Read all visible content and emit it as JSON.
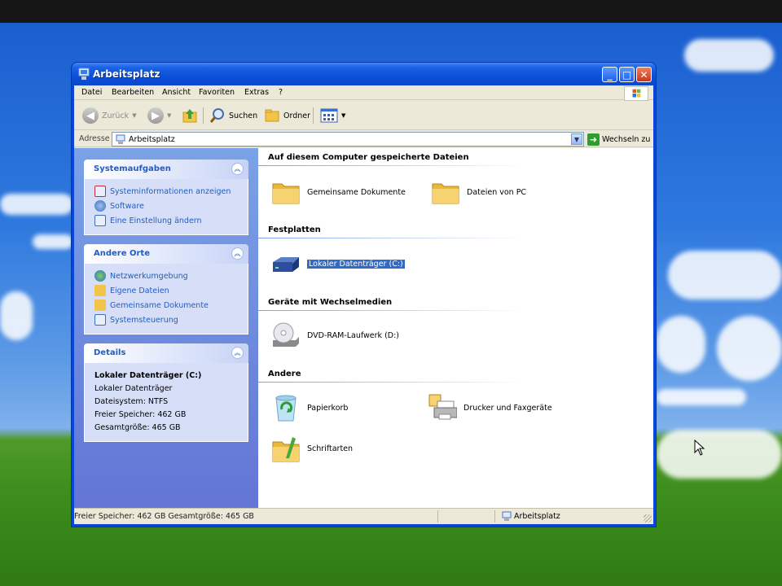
{
  "window": {
    "title": "Arbeitsplatz",
    "minimize": "_",
    "maximize": "□",
    "close": "✕"
  },
  "menu": [
    "Datei",
    "Bearbeiten",
    "Ansicht",
    "Favoriten",
    "Extras",
    "?"
  ],
  "toolbar": {
    "back_label": "Zurück",
    "search_label": "Suchen",
    "folders_label": "Ordner"
  },
  "address": {
    "label": "Adresse",
    "value": "Arbeitsplatz",
    "go_label": "Wechseln zu"
  },
  "left": {
    "system_tasks": {
      "title": "Systemaufgaben",
      "items": [
        "Systeminformationen anzeigen",
        "Software",
        "Eine Einstellung ändern"
      ]
    },
    "other_places": {
      "title": "Andere Orte",
      "items": [
        "Netzwerkumgebung",
        "Eigene Dateien",
        "Gemeinsame Dokumente",
        "Systemsteuerung"
      ]
    },
    "details": {
      "title": "Details",
      "name": "Lokaler Datenträger (C:)",
      "type": "Lokaler Datenträger",
      "filesystem": "Dateisystem: NTFS",
      "free": "Freier Speicher: 462 GB",
      "total": "Gesamtgröße: 465 GB"
    }
  },
  "groups": {
    "stored_files": {
      "title": "Auf diesem Computer gespeicherte Dateien",
      "items": [
        "Gemeinsame Dokumente",
        "Dateien von PC"
      ]
    },
    "hard_disks": {
      "title": "Festplatten",
      "items": [
        "Lokaler Datenträger (C:)"
      ]
    },
    "removable": {
      "title": "Geräte mit Wechselmedien",
      "items": [
        "DVD-RAM-Laufwerk (D:)"
      ]
    },
    "other": {
      "title": "Andere",
      "items": [
        "Papierkorb",
        "Drucker und Faxgeräte",
        "Schriftarten"
      ]
    }
  },
  "status": {
    "left": "Freier Speicher: 462 GB Gesamtgröße: 465 GB",
    "right": "Arbeitsplatz"
  },
  "colors": {
    "title_blue": "#0a50d8",
    "link_blue": "#215dc6",
    "selection": "#316ac5",
    "folder_yellow": "#f2c44a"
  }
}
